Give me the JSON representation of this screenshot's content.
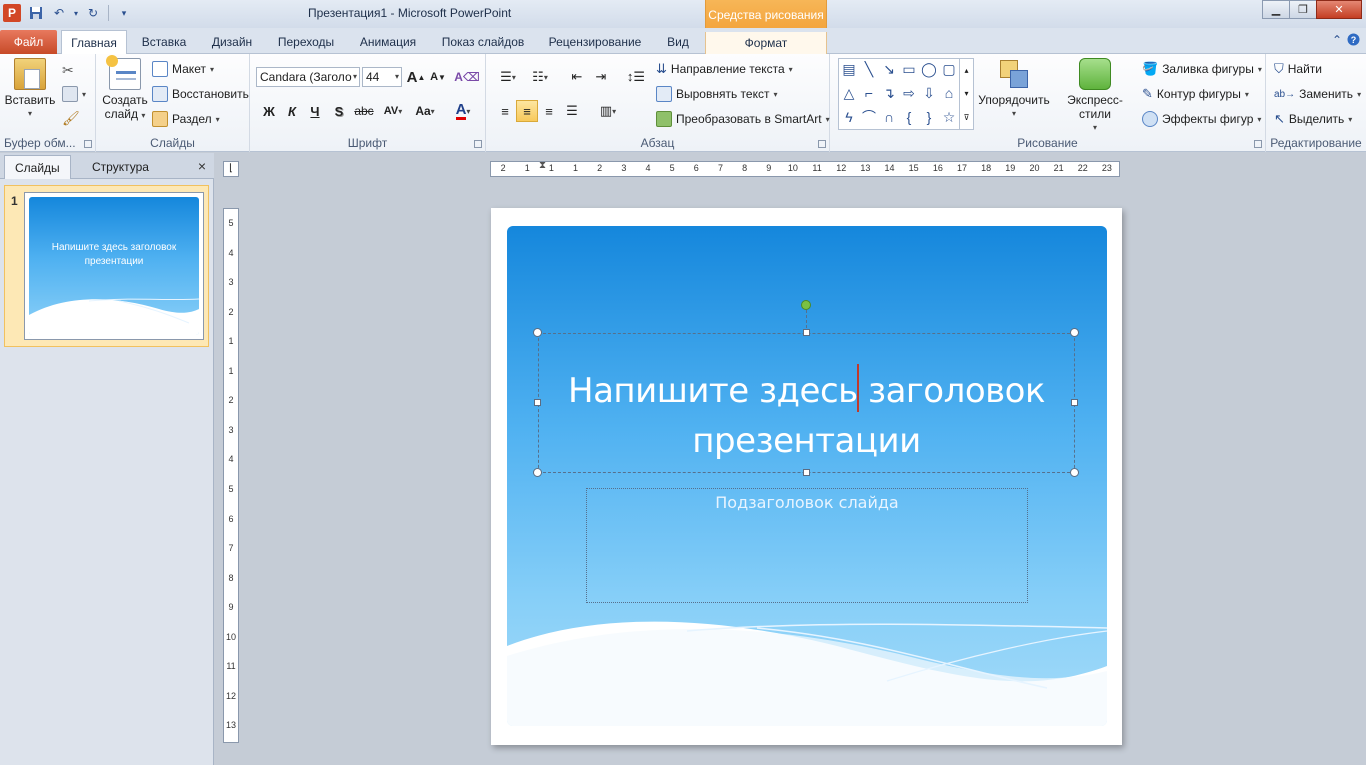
{
  "app": {
    "logo_letter": "P",
    "window_title": "Презентация1  -  Microsoft PowerPoint",
    "context_tab_header": "Средства рисования"
  },
  "tabs": {
    "file": "Файл",
    "home": "Главная",
    "insert": "Вставка",
    "design": "Дизайн",
    "transitions": "Переходы",
    "animation": "Анимация",
    "slideshow": "Показ слайдов",
    "review": "Рецензирование",
    "view": "Вид",
    "format": "Формат"
  },
  "ribbon": {
    "clipboard": {
      "paste": "Вставить",
      "label": "Буфер обм..."
    },
    "slides": {
      "new_slide_line1": "Создать",
      "new_slide_line2": "слайд",
      "layout": "Макет",
      "reset": "Восстановить",
      "section": "Раздел",
      "label": "Слайды"
    },
    "font": {
      "font_name": "Candara (Заголо",
      "font_size": "44",
      "bold": "Ж",
      "italic": "К",
      "underline": "Ч",
      "shadow": "S",
      "strikethrough": "abc",
      "spacing": "AV",
      "change_case": "Aa",
      "color": "A",
      "grow": "A",
      "shrink": "A",
      "label": "Шрифт"
    },
    "paragraph": {
      "text_direction": "Направление текста",
      "align_text": "Выровнять текст",
      "smartart": "Преобразовать в SmartArt",
      "label": "Абзац"
    },
    "drawing": {
      "arrange": "Упорядочить",
      "quick_styles": "Экспресс-стили",
      "shape_fill": "Заливка фигуры",
      "shape_outline": "Контур фигуры",
      "shape_effects": "Эффекты фигур",
      "label": "Рисование"
    },
    "editing": {
      "find": "Найти",
      "replace": "Заменить",
      "select": "Выделить",
      "label": "Редактирование"
    }
  },
  "left_pane": {
    "tab_slides": "Слайды",
    "tab_outline": "Структура",
    "close": "×",
    "slide_number": "1",
    "thumb_title": "Напишите здесь заголовок презентации"
  },
  "slide": {
    "title_part1": "Напишите здесь",
    "title_part2": " заголовок",
    "title_line2": "презентации",
    "subtitle": "Подзаголовок слайда"
  },
  "rulers": {
    "h_ticks": [
      "2",
      "1",
      "1",
      "1",
      "2",
      "3",
      "4",
      "5",
      "6",
      "7",
      "8",
      "9",
      "10",
      "11",
      "12",
      "13",
      "14",
      "15",
      "16",
      "17",
      "18",
      "19",
      "20",
      "21",
      "22",
      "23"
    ],
    "v_ticks": [
      "5",
      "4",
      "3",
      "2",
      "1",
      "1",
      "2",
      "3",
      "4",
      "5",
      "6",
      "7",
      "8",
      "9",
      "10",
      "11",
      "12",
      "13"
    ]
  },
  "colors": {
    "file_tab": "#c74a28",
    "context_tab": "#f3a33b",
    "slide_top": "#1587dc",
    "slide_bottom": "#a5dbf9"
  }
}
